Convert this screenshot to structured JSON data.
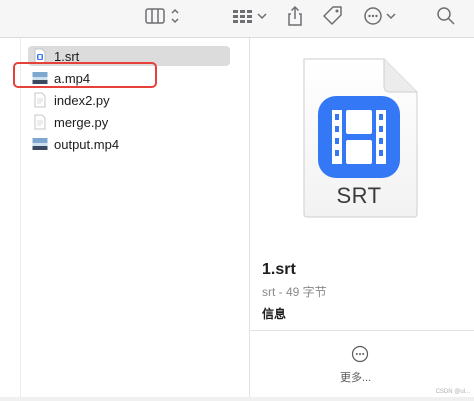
{
  "files": [
    {
      "name": "1.srt",
      "icon": "srt-file-icon",
      "selected": true
    },
    {
      "name": "a.mp4",
      "icon": "video-file-icon",
      "selected": false
    },
    {
      "name": "index2.py",
      "icon": "python-file-icon",
      "selected": false
    },
    {
      "name": "merge.py",
      "icon": "python-file-icon",
      "selected": false
    },
    {
      "name": "output.mp4",
      "icon": "video-file-icon",
      "selected": false
    }
  ],
  "preview": {
    "doc_type": "SRT",
    "name": "1.srt",
    "meta": "srt - 49 字节",
    "info_label": "信息",
    "more_label": "更多..."
  },
  "watermark": "CSDN @ul...",
  "colors": {
    "highlight": "#e5413a",
    "icon_blue": "#3478f6",
    "selection": "#dcdcdc"
  }
}
